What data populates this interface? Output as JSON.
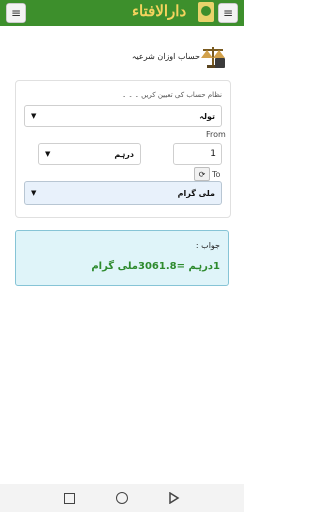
{
  "header": {
    "logo_text": "دارالافتاء",
    "left_menu_icon": "menu-icon",
    "right_menu_icon": "menu-icon"
  },
  "page": {
    "title": "حساب اوزان شرعیہ",
    "icon": "scale-icon"
  },
  "form": {
    "hint": "نظام حساب کی تعیین کریں ۔ ۔ ۔",
    "system_select": "تولہ",
    "from_label": "From",
    "from_unit": "درہم",
    "from_amount": "1",
    "swap_icon": "refresh-icon",
    "to_label": "To",
    "to_unit": "ملی گرام"
  },
  "result": {
    "label": "جواب :",
    "value": "1درہم =3061.8ملی گرام"
  },
  "navbar": {
    "items": [
      "recent-apps-icon",
      "home-icon",
      "back-icon"
    ]
  },
  "colors": {
    "header_bg": "#3d8f2c",
    "answer_bg": "#dff4f9",
    "answer_text": "#2d8a2d",
    "to_select_bg": "#e8f1fb"
  }
}
